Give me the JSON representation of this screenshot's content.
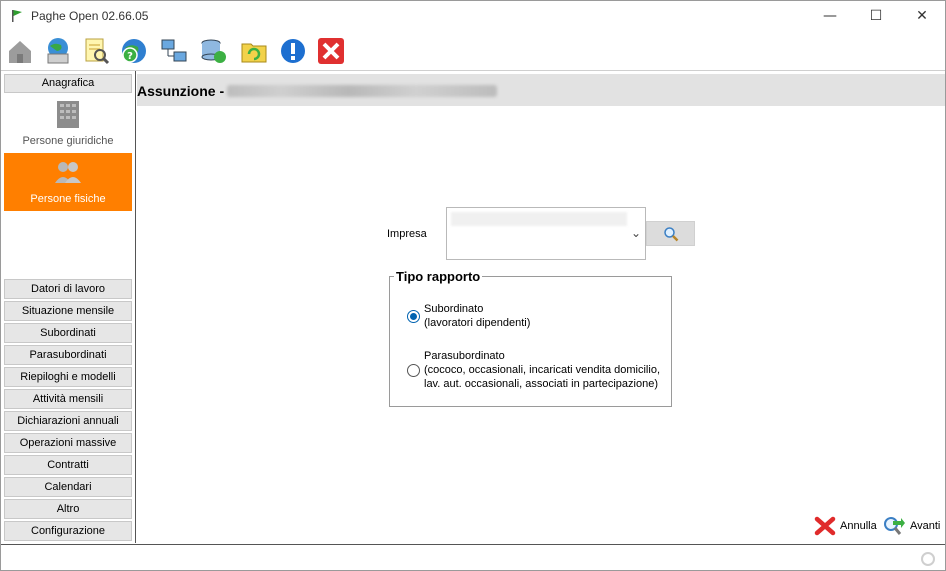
{
  "window": {
    "title": "Paghe Open 02.66.05",
    "controls": {
      "minimize": "—",
      "maximize": "☐",
      "close": "✕"
    }
  },
  "toolbar": {
    "icons": [
      "home-icon",
      "globe-printer-icon",
      "search-document-icon",
      "help-globe-icon",
      "network-icon",
      "database-sync-icon",
      "folder-refresh-icon",
      "info-icon",
      "exit-icon"
    ]
  },
  "sidebar": {
    "header": "Anagrafica",
    "entries": [
      {
        "label": "Persone giuridiche",
        "icon": "building-icon",
        "active": false
      },
      {
        "label": "Persone fisiche",
        "icon": "people-icon",
        "active": true
      }
    ],
    "buttons": [
      "Datori di lavoro",
      "Situazione mensile",
      "Subordinati",
      "Parasubordinati",
      "Riepiloghi e modelli",
      "Attività mensili",
      "Dichiarazioni annuali",
      "Operazioni massive",
      "Contratti",
      "Calendari",
      "Altro",
      "Configurazione"
    ]
  },
  "content": {
    "title": "Assunzione -",
    "impresa_label": "Impresa",
    "tipo_rapporto": {
      "legend": "Tipo rapporto",
      "options": [
        {
          "line1": "Subordinato",
          "line2": "(lavoratori dipendenti)",
          "line3": "",
          "checked": true
        },
        {
          "line1": "Parasubordinato",
          "line2": "(cococo, occasionali, incaricati vendita domicilio,",
          "line3": "lav. aut. occasionali, associati in partecipazione)",
          "checked": false
        }
      ]
    },
    "buttons": {
      "cancel": "Annulla",
      "next": "Avanti"
    }
  },
  "colors": {
    "active": "#ff7f00",
    "radio": "#0063b1",
    "exit": "#e03030"
  }
}
